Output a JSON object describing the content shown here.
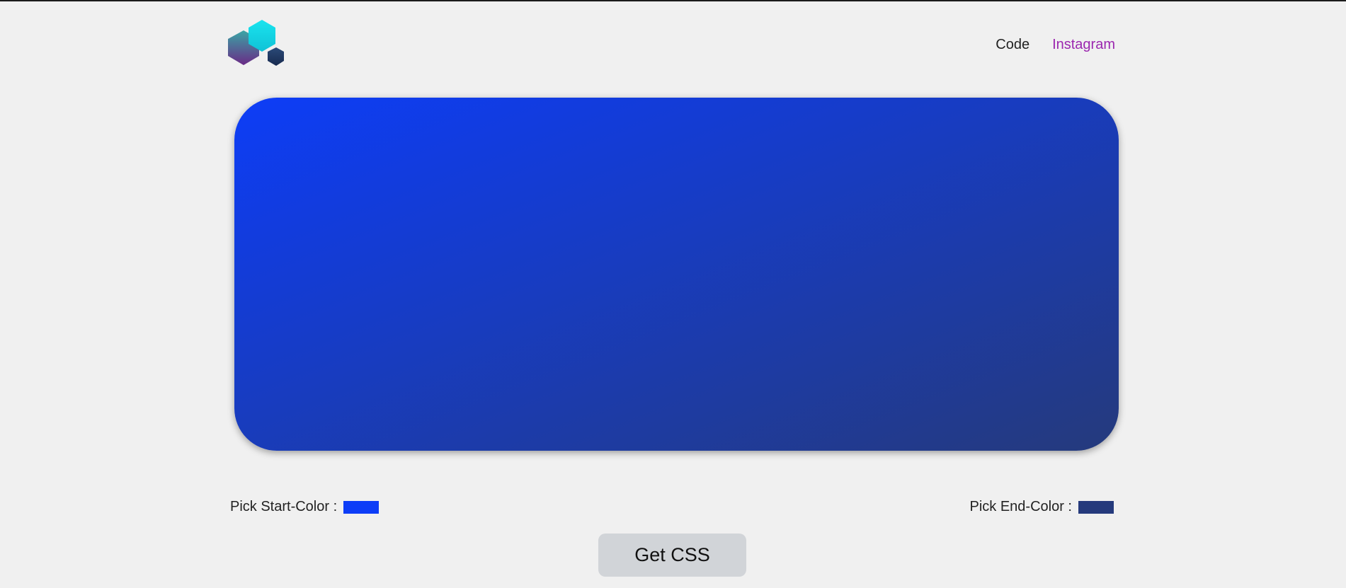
{
  "header": {
    "logo_icon": "hexagon-cluster-logo",
    "nav": {
      "code_label": "Code",
      "instagram_label": "Instagram"
    }
  },
  "preview": {
    "start_color": "#0d3df7",
    "end_color": "#253a7c",
    "gradient_direction": "to bottom right"
  },
  "pickers": {
    "start_label": "Pick Start-Color :",
    "end_label": "Pick End-Color :"
  },
  "actions": {
    "get_css_label": "Get CSS"
  },
  "colors": {
    "page_background": "#f0f0f0",
    "nav_text": "#222222",
    "instagram_link": "#9b27af",
    "button_background": "#d1d4d8"
  }
}
